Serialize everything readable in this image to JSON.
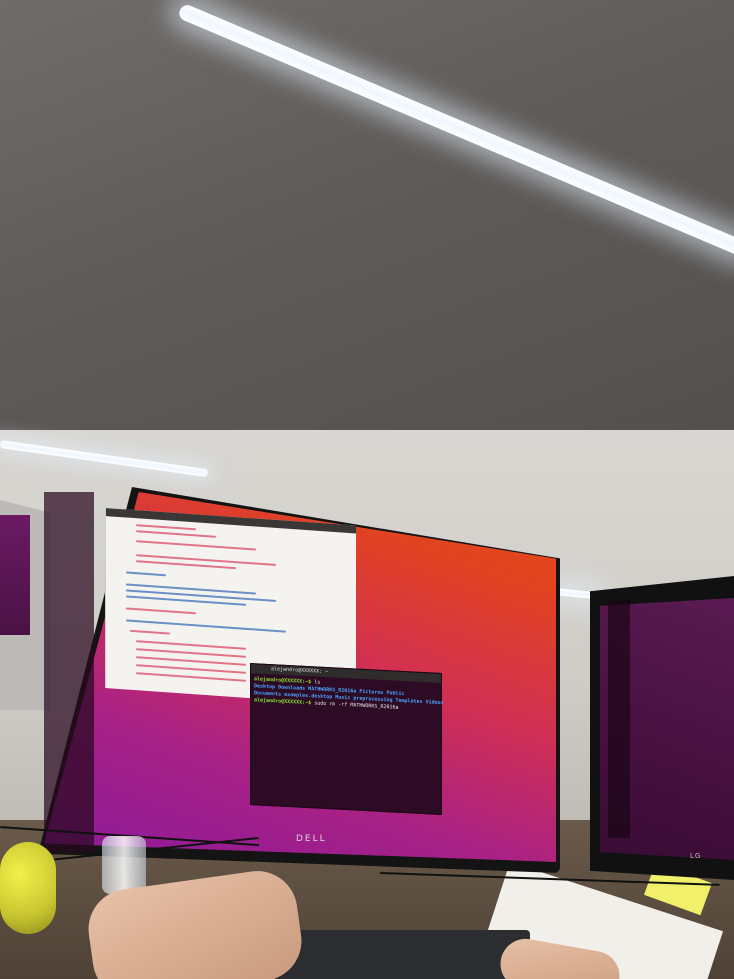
{
  "terminal": {
    "title": "alejandro@XXXXXX: ~",
    "lines": [
      {
        "prompt": "alejandro@XXXXXX:~$",
        "cmd": " ls"
      },
      {
        "prompt": "",
        "cmd": "Desktop    Downloads    MATHWORKS_R2016a    Pictures    Public"
      },
      {
        "prompt": "",
        "cmd": "Documents  examples.desktop  Music  preprocessing  Templates  Videos"
      },
      {
        "prompt": "alejandro@XXXXXX:~$",
        "cmd": " sudo rm -rf MATHWORKS_R2016a"
      }
    ]
  },
  "monitor_brand": "DELL",
  "right_monitor_brand": "LG",
  "colors": {
    "wallpaper_orange": "#e2481d",
    "wallpaper_purple": "#8b1a9a",
    "terminal_bg": "#2d0b24",
    "prompt_green": "#8ae234",
    "directory_blue": "#4aa3ff"
  },
  "icons": [
    "ubuntu-logo-icon",
    "files-icon",
    "firefox-icon",
    "libreoffice-writer-icon",
    "software-center-icon",
    "settings-icon",
    "terminal-icon",
    "trash-icon"
  ]
}
